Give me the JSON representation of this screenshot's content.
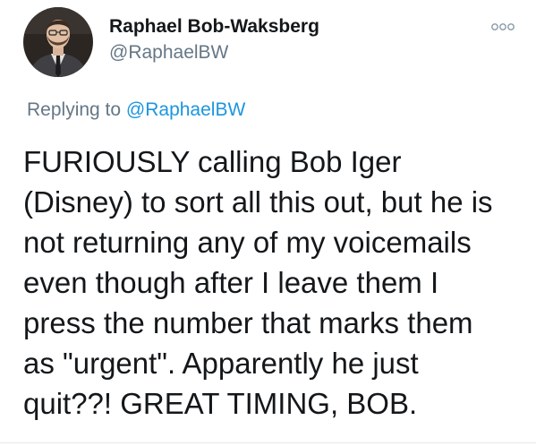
{
  "author": {
    "display_name": "Raphael Bob-Waksberg",
    "handle": "@RaphaelBW",
    "avatar_icon": "avatar-photo"
  },
  "reply": {
    "prefix": "Replying to",
    "mention": "@RaphaelBW"
  },
  "tweet": {
    "lines": [
      "FURIOUSLY calling Bob Iger",
      "(Disney) to sort all this out, but he is",
      "not returning any of my voicemails",
      "even though after I leave them I",
      "press the number that marks them",
      "as \"urgent\". Apparently he just",
      "quit??! GREAT TIMING, BOB."
    ]
  },
  "more_icon": "more-options-icon",
  "colors": {
    "secondary_text": "#657786",
    "link": "#1b95e0",
    "primary_text": "#14171a"
  }
}
